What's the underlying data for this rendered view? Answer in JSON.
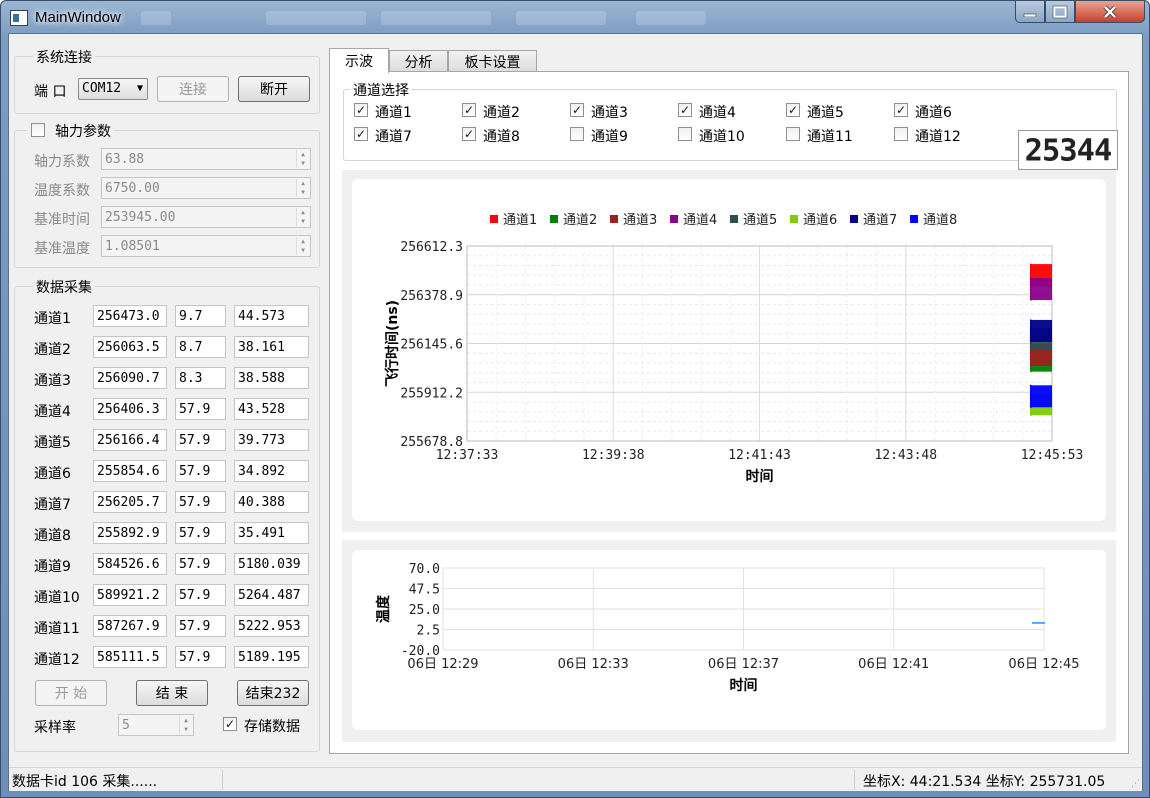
{
  "window": {
    "title": "MainWindow"
  },
  "connection": {
    "group_title": "系统连接",
    "port_label": "端 口",
    "port_value": "COM12",
    "connect_label": "连接",
    "disconnect_label": "断开"
  },
  "axial": {
    "group_title": "轴力参数",
    "checked": false,
    "fields": [
      {
        "label": "轴力系数",
        "value": "63.88"
      },
      {
        "label": "温度系数",
        "value": "6750.00"
      },
      {
        "label": "基准时间",
        "value": "253945.00"
      },
      {
        "label": "基准温度",
        "value": "1.08501"
      }
    ]
  },
  "acquisition": {
    "group_title": "数据采集",
    "rows": [
      {
        "label": "通道1",
        "a": "256473.0",
        "b": "9.7",
        "c": "44.573"
      },
      {
        "label": "通道2",
        "a": "256063.5",
        "b": "8.7",
        "c": "38.161"
      },
      {
        "label": "通道3",
        "a": "256090.7",
        "b": "8.3",
        "c": "38.588"
      },
      {
        "label": "通道4",
        "a": "256406.3",
        "b": "57.9",
        "c": "43.528"
      },
      {
        "label": "通道5",
        "a": "256166.4",
        "b": "57.9",
        "c": "39.773"
      },
      {
        "label": "通道6",
        "a": "255854.6",
        "b": "57.9",
        "c": "34.892"
      },
      {
        "label": "通道7",
        "a": "256205.7",
        "b": "57.9",
        "c": "40.388"
      },
      {
        "label": "通道8",
        "a": "255892.9",
        "b": "57.9",
        "c": "35.491"
      },
      {
        "label": "通道9",
        "a": "584526.6",
        "b": "57.9",
        "c": "5180.039"
      },
      {
        "label": "通道10",
        "a": "589921.2",
        "b": "57.9",
        "c": "5264.487"
      },
      {
        "label": "通道11",
        "a": "587267.9",
        "b": "57.9",
        "c": "5222.953"
      },
      {
        "label": "通道12",
        "a": "585111.5",
        "b": "57.9",
        "c": "5189.195"
      }
    ],
    "start_label": "开 始",
    "stop_label": "结 束",
    "stop232_label": "结束232",
    "rate_label": "采样率",
    "rate_value": "5",
    "store_label": "存储数据",
    "store_checked": true
  },
  "tabs": [
    {
      "label": "示波",
      "active": true
    },
    {
      "label": "分析",
      "active": false
    },
    {
      "label": "板卡设置",
      "active": false
    }
  ],
  "channel_select": {
    "group_title": "通道选择",
    "counter": "25344",
    "channels": [
      {
        "label": "通道1",
        "checked": true
      },
      {
        "label": "通道2",
        "checked": true
      },
      {
        "label": "通道3",
        "checked": true
      },
      {
        "label": "通道4",
        "checked": true
      },
      {
        "label": "通道5",
        "checked": true
      },
      {
        "label": "通道6",
        "checked": true
      },
      {
        "label": "通道7",
        "checked": true
      },
      {
        "label": "通道8",
        "checked": true
      },
      {
        "label": "通道9",
        "checked": false
      },
      {
        "label": "通道10",
        "checked": false
      },
      {
        "label": "通道11",
        "checked": false
      },
      {
        "label": "通道12",
        "checked": false
      }
    ]
  },
  "chart_data": [
    {
      "type": "scatter",
      "ylabel": "飞行时间(ns)",
      "xlabel": "时间",
      "ylim": [
        255678.8,
        256612.3
      ],
      "yticks": [
        "256612.3",
        "256378.9",
        "256145.6",
        "255912.2",
        "255678.8"
      ],
      "xticks": [
        "12:37:33",
        "12:39:38",
        "12:41:43",
        "12:43:48",
        "12:45:53"
      ],
      "grid": true,
      "legend_position": "top",
      "series": [
        {
          "name": "通道1",
          "color": "#ff0000",
          "y": [
            256473.0
          ]
        },
        {
          "name": "通道2",
          "color": "#008000",
          "y": [
            256063.5
          ]
        },
        {
          "name": "通道3",
          "color": "#a02020",
          "y": [
            256090.7
          ]
        },
        {
          "name": "通道4",
          "color": "#8b008b",
          "y": [
            256406.3
          ]
        },
        {
          "name": "通道5",
          "color": "#2f4f4f",
          "y": [
            256166.4
          ]
        },
        {
          "name": "通道6",
          "color": "#7fcc00",
          "y": [
            255854.6
          ]
        },
        {
          "name": "通道7",
          "color": "#00008b",
          "y": [
            256205.7
          ]
        },
        {
          "name": "通道8",
          "color": "#0000ff",
          "y": [
            255892.9
          ]
        }
      ],
      "x_last": "12:45:53"
    },
    {
      "type": "line",
      "ylabel": "温度",
      "xlabel": "时间",
      "ylim": [
        -20.0,
        70.0
      ],
      "yticks": [
        "70.0",
        "47.5",
        "25.0",
        "2.5",
        "-20.0"
      ],
      "xticks": [
        "06日 12:29",
        "06日 12:33",
        "06日 12:37",
        "06日 12:41",
        "06日 12:45"
      ],
      "grid": true,
      "series": [
        {
          "name": "",
          "color": "#1e90ff",
          "y": [
            9.7
          ]
        }
      ]
    }
  ],
  "status": {
    "left": "数据卡id 106 采集......",
    "right": "坐标X: 44:21.534  坐标Y: 255731.05"
  }
}
